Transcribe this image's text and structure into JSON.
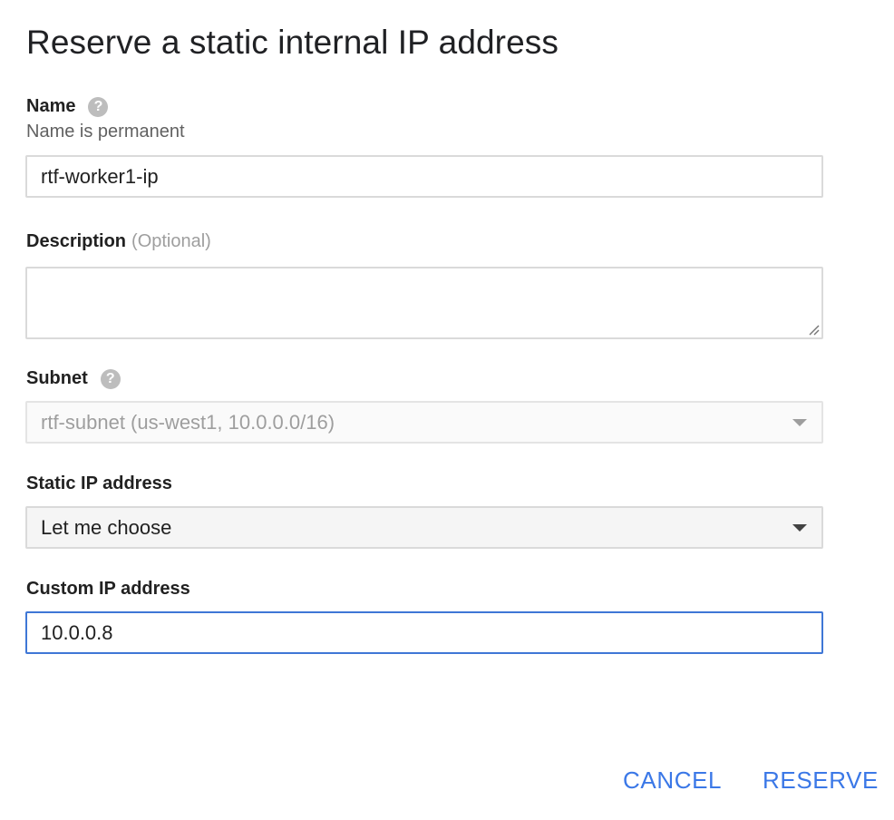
{
  "dialog": {
    "title": "Reserve a static internal IP address"
  },
  "name_field": {
    "label": "Name",
    "help_icon": "help-icon",
    "hint": "Name is permanent",
    "value": "rtf-worker1-ip"
  },
  "description_field": {
    "label": "Description",
    "optional": "(Optional)",
    "value": ""
  },
  "subnet_field": {
    "label": "Subnet",
    "help_icon": "help-icon",
    "selected": "rtf-subnet (us-west1, 10.0.0.0/16)"
  },
  "static_ip_field": {
    "label": "Static IP address",
    "selected": "Let me choose"
  },
  "custom_ip_field": {
    "label": "Custom IP address",
    "value": "10.0.0.8"
  },
  "actions": {
    "cancel_label": "CANCEL",
    "reserve_label": "RESERVE"
  },
  "colors": {
    "accent": "#3b78e7",
    "focus_border": "#3f77d6",
    "help_icon_bg": "#bdbdbd"
  }
}
